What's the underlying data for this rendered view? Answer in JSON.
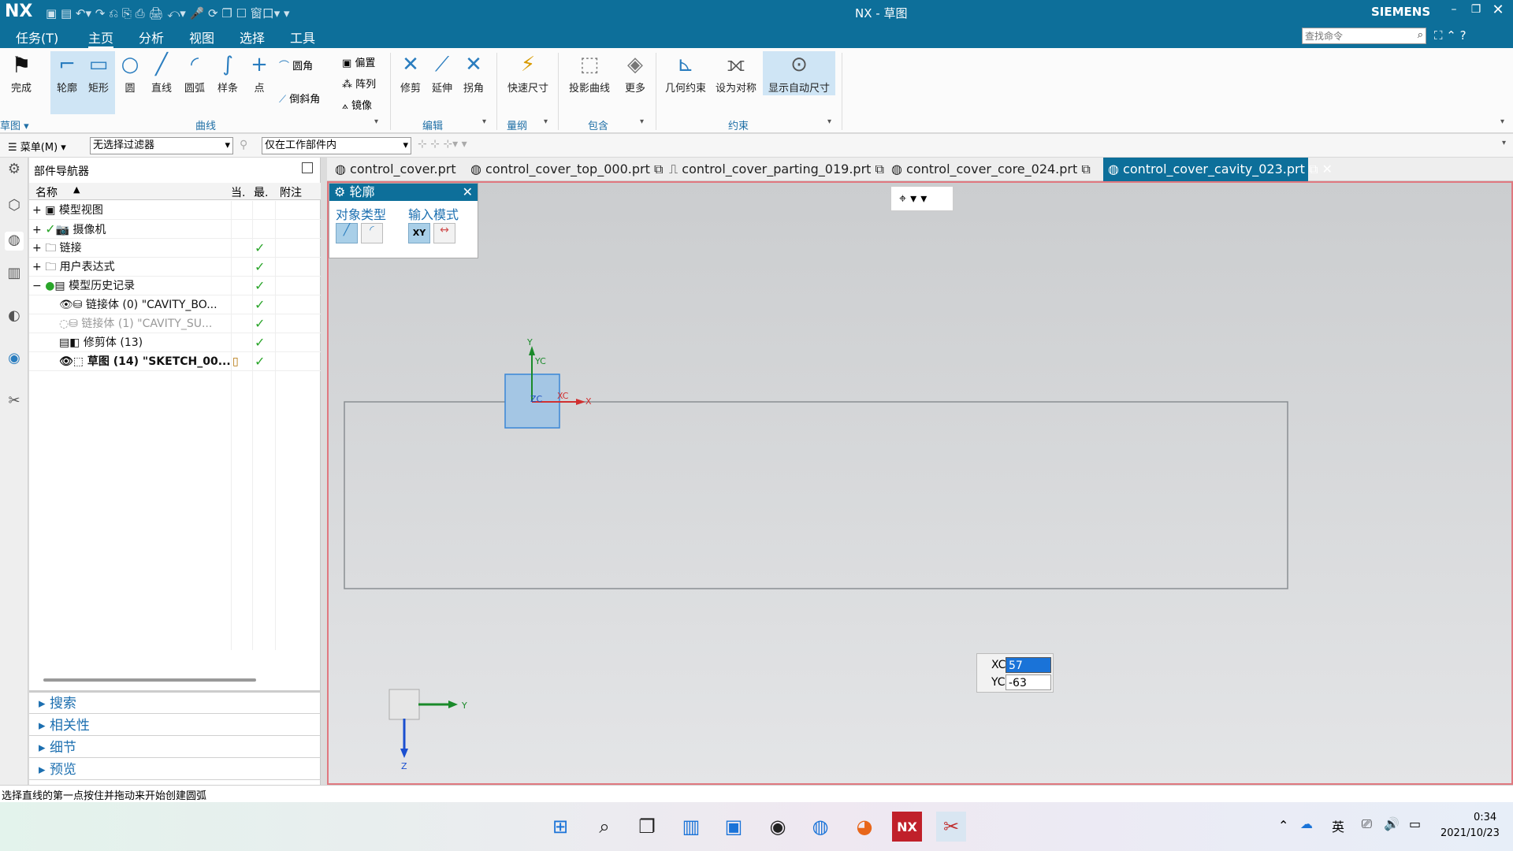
{
  "title_bar": {
    "logo": "NX",
    "title": "NX - 草图",
    "brand": "SIEMENS"
  },
  "menu": {
    "items": [
      "任务(T)",
      "主页",
      "分析",
      "视图",
      "选择",
      "工具"
    ],
    "active": "主页",
    "search_placeholder": "查找命令"
  },
  "ribbon": {
    "done": "完成",
    "curve_buttons": [
      "轮廓",
      "矩形",
      "圆",
      "直线",
      "圆弧",
      "样条",
      "点"
    ],
    "fillet": "圆角",
    "chamfer": "倒斜角",
    "small": [
      "偏置",
      "阵列",
      "镜像"
    ],
    "edit_buttons": [
      "修剪",
      "延伸",
      "拐角"
    ],
    "quick_dim": "快速尺寸",
    "project": "投影曲线",
    "more": "更多",
    "constraint_buttons": [
      "几何约束",
      "设为对称",
      "显示自动尺寸"
    ],
    "groups": [
      "草图",
      "曲线",
      "编辑",
      "量纲",
      "包含",
      "约束"
    ]
  },
  "toolbar2": {
    "menu": "菜单(M)",
    "filter": "无选择过滤器",
    "scope": "仅在工作部件内"
  },
  "navigator": {
    "title": "部件导航器",
    "columns": [
      "名称",
      "当.",
      "最.",
      "附注"
    ],
    "rows": [
      {
        "label": "模型视图",
        "check": ""
      },
      {
        "label": "摄像机",
        "check": ""
      },
      {
        "label": "链接",
        "check": "✓"
      },
      {
        "label": "用户表达式",
        "check": "✓"
      },
      {
        "label": "模型历史记录",
        "check": "✓"
      },
      {
        "label": "链接体 (0) \"CAVITY_BO...",
        "check": "✓"
      },
      {
        "label": "链接体 (1) \"CAVITY_SU...",
        "check": "✓"
      },
      {
        "label": "修剪体 (13)",
        "check": "✓"
      },
      {
        "label": "草图 (14) \"SKETCH_00...",
        "check": "✓"
      }
    ],
    "sections": [
      "搜索",
      "相关性",
      "细节",
      "预览"
    ]
  },
  "tabs": [
    "control_cover.prt",
    "control_cover_top_000.prt",
    "control_cover_parting_019.prt",
    "control_cover_core_024.prt",
    "control_cover_cavity_023.prt"
  ],
  "profile_dialog": {
    "title": "轮廓",
    "object_type": "对象类型",
    "input_mode": "输入模式",
    "xy": "XY"
  },
  "axes": {
    "y": "Y",
    "yc": "YC",
    "x": "X",
    "xc": "XC",
    "zc": "ZC",
    "tri_y": "Y",
    "tri_z": "Z"
  },
  "coord_input": {
    "xc_label": "XC",
    "xc_value": "57",
    "yc_label": "YC",
    "yc_value": "-63"
  },
  "status": "选择直线的第一点按住并拖动来开始创建圆弧",
  "taskbar": {
    "tray_lang": "英",
    "time": "0:34",
    "date": "2021/10/23"
  }
}
